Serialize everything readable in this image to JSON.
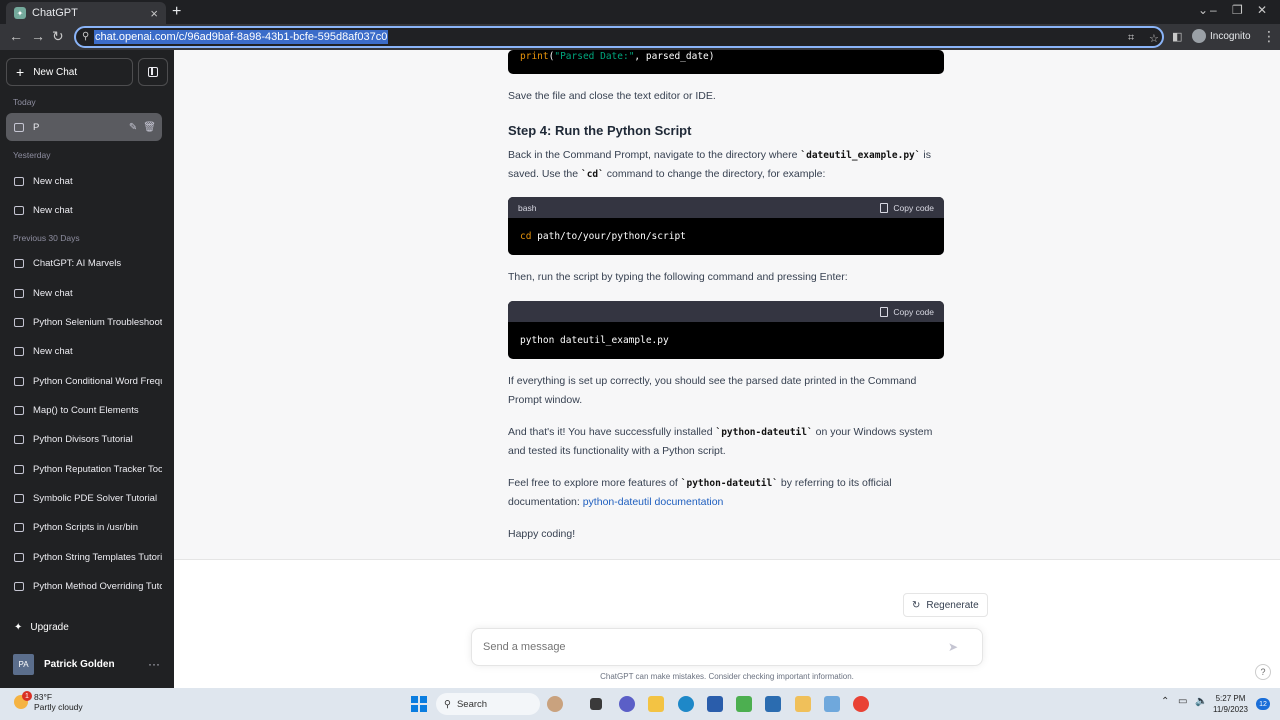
{
  "browser": {
    "tab_title": "ChatGPT",
    "url": "chat.openai.com/c/96ad9baf-8a98-43b1-bcfe-595d8af037c0",
    "profile_label": "Incognito"
  },
  "sidebar": {
    "new_chat_label": "New Chat",
    "sections": {
      "today": "Today",
      "yesterday": "Yesterday",
      "previous_30": "Previous 30 Days"
    },
    "active_chat": "P",
    "yesterday_items": [
      "New chat",
      "New chat"
    ],
    "older_items": [
      "ChatGPT: AI Marvels",
      "New chat",
      "Python Selenium Troubleshooting",
      "New chat",
      "Python Conditional Word Frequency",
      "Map() to Count Elements",
      "Python Divisors Tutorial",
      "Python Reputation Tracker Tool",
      "Symbolic PDE Solver Tutorial",
      "Python Scripts in /usr/bin",
      "Python String Templates Tutorial",
      "Python Method Overriding Tutorial"
    ],
    "upgrade_label": "Upgrade",
    "user_initials": "PA",
    "user_name": "Patrick Golden"
  },
  "content": {
    "code0": {
      "fn": "print",
      "open": "(",
      "str": "\"Parsed Date:\"",
      "rest": ", parsed_date)"
    },
    "p_save": "Save the file and close the text editor or IDE.",
    "step4_heading": "Step 4: Run the Python Script",
    "p_back_1": "Back in the Command Prompt, navigate to the directory where ",
    "p_back_code1": "`dateutil_example.py`",
    "p_back_2": " is saved. Use the ",
    "p_back_code2": "`cd`",
    "p_back_3": " command to change the directory, for example:",
    "code1": {
      "lang": "bash",
      "copy": "Copy code",
      "cmd": "cd",
      "arg": " path/to/your/python/script"
    },
    "p_then": "Then, run the script by typing the following command and pressing Enter:",
    "code2": {
      "copy": "Copy code",
      "text": "python dateutil_example.py"
    },
    "p_if": "If everything is set up correctly, you should see the parsed date printed in the Command Prompt window.",
    "p_thats_1": "And that's it! You have successfully installed ",
    "p_thats_code": "`python-dateutil`",
    "p_thats_2": " on your Windows system and tested its functionality with a Python script.",
    "p_feel_1": "Feel free to explore more features of ",
    "p_feel_code": "`python-dateutil`",
    "p_feel_2": " by referring to its official documentation: ",
    "p_feel_link": "python-dateutil documentation",
    "p_happy": "Happy coding!"
  },
  "composer": {
    "regenerate_label": "Regenerate",
    "placeholder": "Send a message",
    "disclaimer": "ChatGPT can make mistakes. Consider checking important information.",
    "help_label": "?"
  },
  "taskbar": {
    "temp": "83°F",
    "condition": "Partly cloudy",
    "weather_badge": "1",
    "search_label": "Search",
    "time": "5:27 PM",
    "date": "11/9/2023",
    "notif_count": "12"
  },
  "colors": {
    "sidebar_bg": "#202123",
    "answer_bg": "#f7f7f8",
    "code_bg": "#000000",
    "link": "#1f5fbf"
  }
}
